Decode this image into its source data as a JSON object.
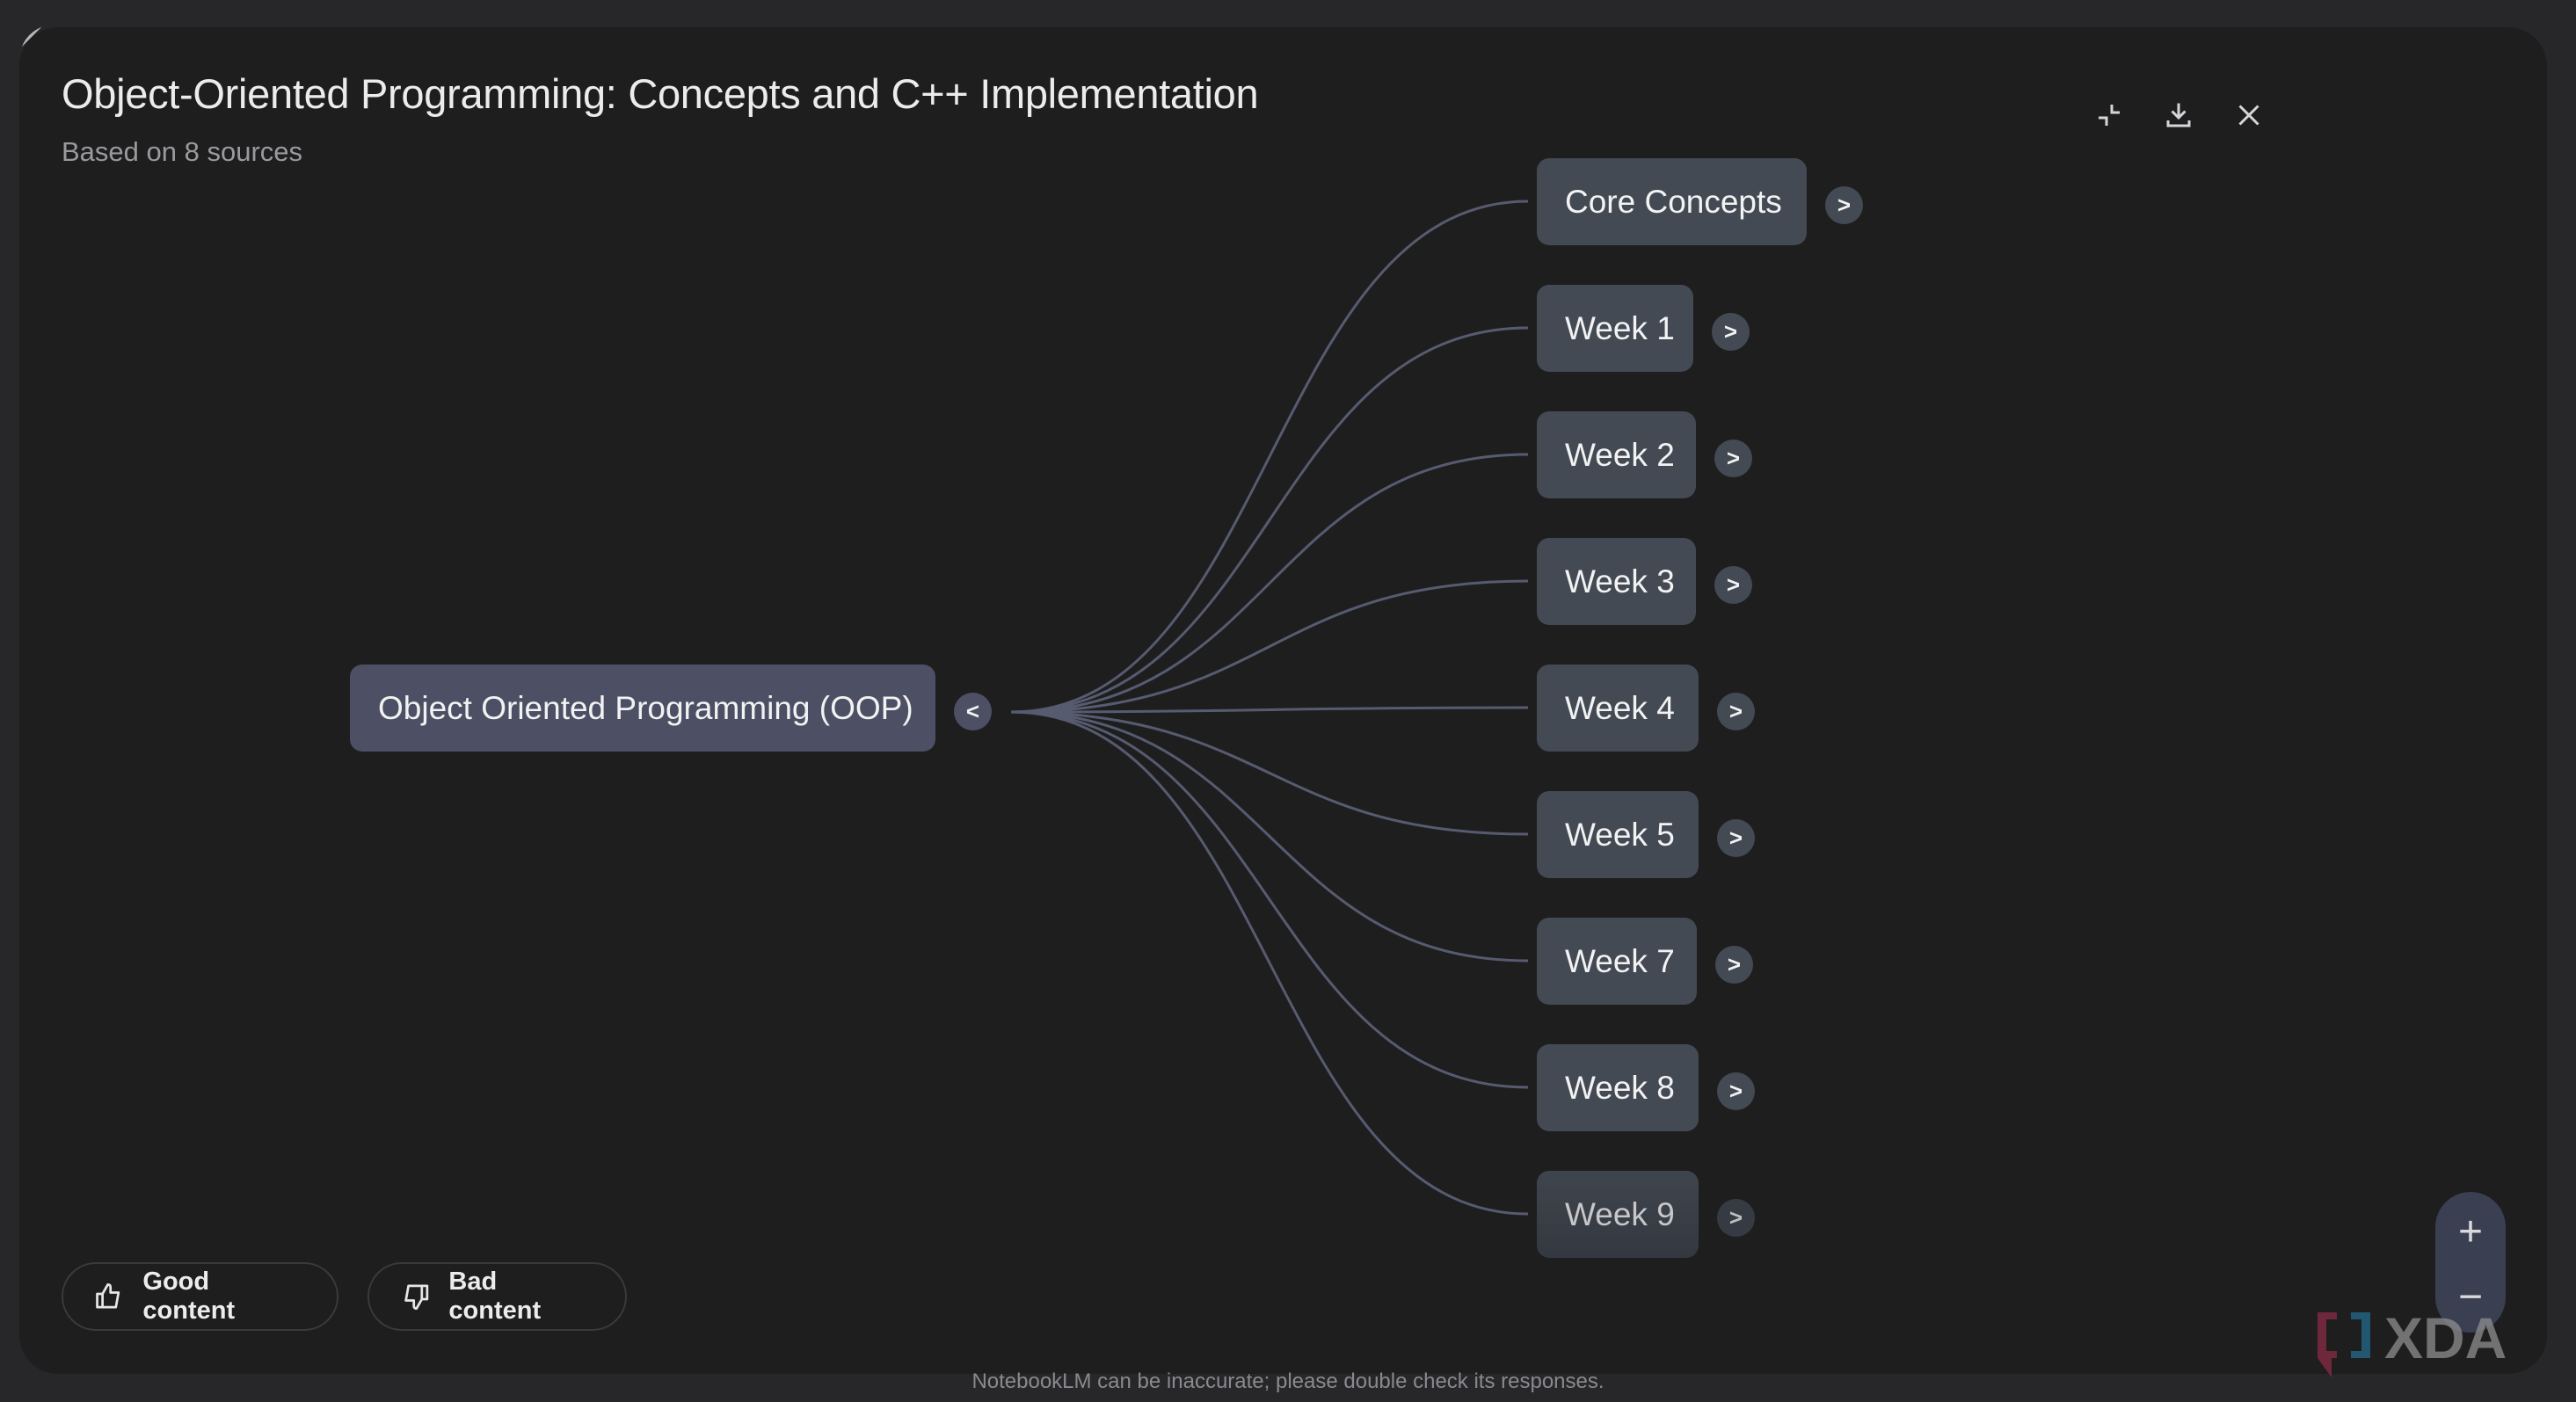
{
  "header": {
    "title": "Object-Oriented Programming: Concepts and C++ Implementation",
    "subtitle": "Based on 8 sources",
    "actions": [
      {
        "name": "collapse-icon",
        "label": "Collapse"
      },
      {
        "name": "download-icon",
        "label": "Download"
      },
      {
        "name": "close-icon",
        "label": "Close"
      }
    ]
  },
  "mindmap": {
    "root": {
      "label": "Object Oriented Programming (OOP)",
      "toggle": "<"
    },
    "children": [
      {
        "label": "Core Concepts",
        "toggle": ">"
      },
      {
        "label": "Week 1",
        "toggle": ">"
      },
      {
        "label": "Week 2",
        "toggle": ">"
      },
      {
        "label": "Week 3",
        "toggle": ">"
      },
      {
        "label": "Week 4",
        "toggle": ">"
      },
      {
        "label": "Week 5",
        "toggle": ">"
      },
      {
        "label": "Week 7",
        "toggle": ">"
      },
      {
        "label": "Week 8",
        "toggle": ">"
      },
      {
        "label": "Week 9",
        "toggle": ">"
      }
    ],
    "colors": {
      "link": "#575b70",
      "node": "#434a54",
      "root": "#4d5064"
    }
  },
  "feedback": {
    "good_label": "Good content",
    "bad_label": "Bad content"
  },
  "zoom": {
    "in": "+",
    "out": "−"
  },
  "footer": "NotebookLM can be inaccurate; please double check its responses.",
  "watermark": "XDA"
}
